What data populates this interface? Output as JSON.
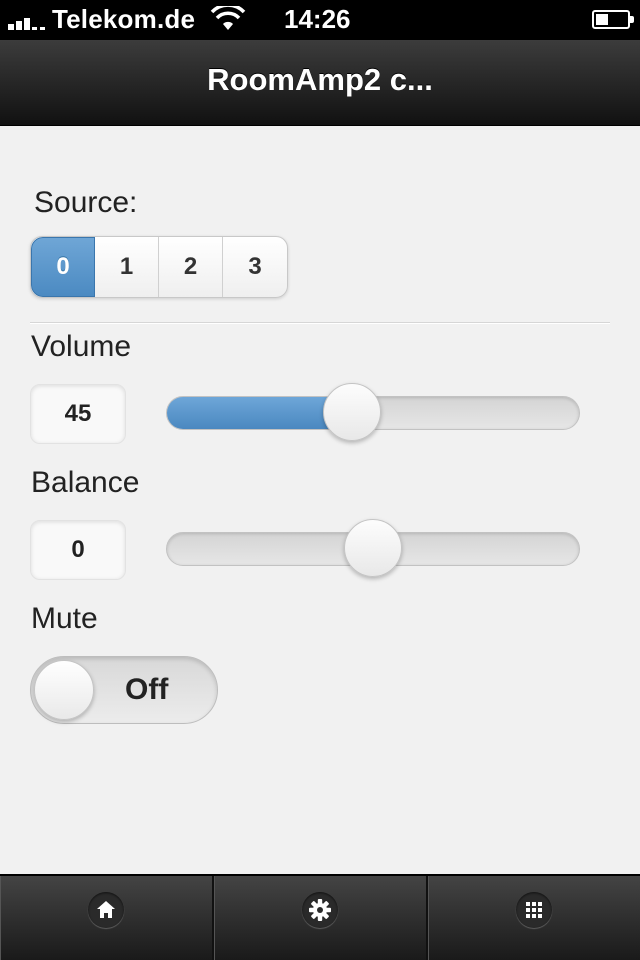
{
  "status_bar": {
    "carrier": "Telekom.de",
    "time": "14:26"
  },
  "header": {
    "title": "RoomAmp2 c..."
  },
  "source": {
    "label": "Source:",
    "options": [
      "0",
      "1",
      "2",
      "3"
    ],
    "selected": "0"
  },
  "volume": {
    "label": "Volume",
    "value": "45",
    "level_percent": 45
  },
  "balance": {
    "label": "Balance",
    "value": "0",
    "level_percent": 50
  },
  "mute": {
    "label": "Mute",
    "state": "Off"
  },
  "footer": {
    "tabs": [
      {
        "icon": "home-icon"
      },
      {
        "icon": "gear-icon"
      },
      {
        "icon": "grid-icon"
      }
    ]
  },
  "colors": {
    "accent": "#4b8ac2",
    "header": "#111111",
    "background": "#f1f1f1"
  }
}
